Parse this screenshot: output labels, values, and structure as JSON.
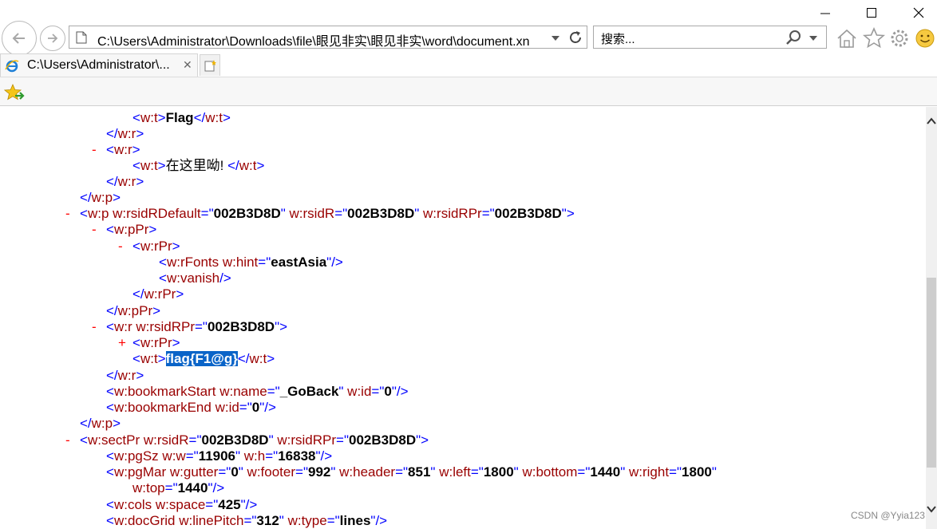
{
  "window": {
    "minimize_glyph": "—",
    "maximize_glyph": "☐",
    "close_glyph": "✕"
  },
  "address_bar": {
    "value": "C:\\Users\\Administrator\\Downloads\\file\\眼见非实\\眼见非实\\word\\document.xn"
  },
  "search": {
    "placeholder": "搜索..."
  },
  "tab": {
    "title": "C:\\Users\\Administrator\\...",
    "close_glyph": "✕"
  },
  "xml_lines": [
    {
      "toggle": "",
      "parts": [
        [
          "bl",
          "<"
        ],
        [
          "tg",
          "w:t"
        ],
        [
          "bl",
          ">"
        ],
        [
          "tx",
          "Flag"
        ],
        [
          "bl",
          "</"
        ],
        [
          "tg",
          "w:t"
        ],
        [
          "bl",
          ">"
        ]
      ]
    },
    {
      "toggle": "",
      "parts": [
        [
          "bl",
          "</"
        ],
        [
          "tg",
          "w:r"
        ],
        [
          "bl",
          ">"
        ]
      ]
    },
    {
      "toggle": "-",
      "parts": [
        [
          "bl",
          "<"
        ],
        [
          "tg",
          "w:r"
        ],
        [
          "bl",
          ">"
        ]
      ]
    },
    {
      "toggle": "",
      "parts": [
        [
          "bl",
          "<"
        ],
        [
          "tg",
          "w:t"
        ],
        [
          "bl",
          ">"
        ],
        [
          "txn",
          "在这里呦! "
        ],
        [
          "bl",
          "</"
        ],
        [
          "tg",
          "w:t"
        ],
        [
          "bl",
          ">"
        ]
      ]
    },
    {
      "toggle": "",
      "parts": [
        [
          "bl",
          "</"
        ],
        [
          "tg",
          "w:r"
        ],
        [
          "bl",
          ">"
        ]
      ]
    },
    {
      "toggle": "",
      "parts": [
        [
          "bl",
          "</"
        ],
        [
          "tg",
          "w:p"
        ],
        [
          "bl",
          ">"
        ]
      ]
    },
    {
      "toggle": "-",
      "parts": [
        [
          "bl",
          "<"
        ],
        [
          "tg",
          "w:p "
        ],
        [
          "an",
          "w:rsidRDefault"
        ],
        [
          "bl",
          "=\""
        ],
        [
          "av",
          "002B3D8D"
        ],
        [
          "bl",
          "\" "
        ],
        [
          "an",
          "w:rsidR"
        ],
        [
          "bl",
          "=\""
        ],
        [
          "av",
          "002B3D8D"
        ],
        [
          "bl",
          "\" "
        ],
        [
          "an",
          "w:rsidRPr"
        ],
        [
          "bl",
          "=\""
        ],
        [
          "av",
          "002B3D8D"
        ],
        [
          "bl",
          "\">"
        ]
      ]
    },
    {
      "toggle": "-",
      "parts": [
        [
          "bl",
          "<"
        ],
        [
          "tg",
          "w:pPr"
        ],
        [
          "bl",
          ">"
        ]
      ]
    },
    {
      "toggle": "-",
      "parts": [
        [
          "bl",
          "<"
        ],
        [
          "tg",
          "w:rPr"
        ],
        [
          "bl",
          ">"
        ]
      ]
    },
    {
      "toggle": "",
      "parts": [
        [
          "bl",
          "<"
        ],
        [
          "tg",
          "w:rFonts "
        ],
        [
          "an",
          "w:hint"
        ],
        [
          "bl",
          "=\""
        ],
        [
          "av",
          "eastAsia"
        ],
        [
          "bl",
          "\"/>"
        ]
      ]
    },
    {
      "toggle": "",
      "parts": [
        [
          "bl",
          "<"
        ],
        [
          "tg",
          "w:vanish"
        ],
        [
          "bl",
          "/>"
        ]
      ]
    },
    {
      "toggle": "",
      "parts": [
        [
          "bl",
          "</"
        ],
        [
          "tg",
          "w:rPr"
        ],
        [
          "bl",
          ">"
        ]
      ]
    },
    {
      "toggle": "",
      "parts": [
        [
          "bl",
          "</"
        ],
        [
          "tg",
          "w:pPr"
        ],
        [
          "bl",
          ">"
        ]
      ]
    },
    {
      "toggle": "-",
      "parts": [
        [
          "bl",
          "<"
        ],
        [
          "tg",
          "w:r "
        ],
        [
          "an",
          "w:rsidRPr"
        ],
        [
          "bl",
          "=\""
        ],
        [
          "av",
          "002B3D8D"
        ],
        [
          "bl",
          "\">"
        ]
      ]
    },
    {
      "toggle": "+",
      "parts": [
        [
          "bl",
          "<"
        ],
        [
          "tg",
          "w:rPr"
        ],
        [
          "bl",
          ">"
        ]
      ]
    },
    {
      "toggle": "",
      "parts": [
        [
          "bl",
          "<"
        ],
        [
          "tg",
          "w:t"
        ],
        [
          "bl",
          ">"
        ],
        [
          "hl",
          "flag{F1@g}"
        ],
        [
          "bl",
          "</"
        ],
        [
          "tg",
          "w:t"
        ],
        [
          "bl",
          ">"
        ]
      ]
    },
    {
      "toggle": "",
      "parts": [
        [
          "bl",
          "</"
        ],
        [
          "tg",
          "w:r"
        ],
        [
          "bl",
          ">"
        ]
      ]
    },
    {
      "toggle": "",
      "parts": [
        [
          "bl",
          "<"
        ],
        [
          "tg",
          "w:bookmarkStart "
        ],
        [
          "an",
          "w:name"
        ],
        [
          "bl",
          "=\""
        ],
        [
          "av",
          "_GoBack"
        ],
        [
          "bl",
          "\" "
        ],
        [
          "an",
          "w:id"
        ],
        [
          "bl",
          "=\""
        ],
        [
          "av",
          "0"
        ],
        [
          "bl",
          "\"/>"
        ]
      ]
    },
    {
      "toggle": "",
      "parts": [
        [
          "bl",
          "<"
        ],
        [
          "tg",
          "w:bookmarkEnd "
        ],
        [
          "an",
          "w:id"
        ],
        [
          "bl",
          "=\""
        ],
        [
          "av",
          "0"
        ],
        [
          "bl",
          "\"/>"
        ]
      ]
    },
    {
      "toggle": "",
      "parts": [
        [
          "bl",
          "</"
        ],
        [
          "tg",
          "w:p"
        ],
        [
          "bl",
          ">"
        ]
      ]
    },
    {
      "toggle": "-",
      "parts": [
        [
          "bl",
          "<"
        ],
        [
          "tg",
          "w:sectPr "
        ],
        [
          "an",
          "w:rsidR"
        ],
        [
          "bl",
          "=\""
        ],
        [
          "av",
          "002B3D8D"
        ],
        [
          "bl",
          "\" "
        ],
        [
          "an",
          "w:rsidRPr"
        ],
        [
          "bl",
          "=\""
        ],
        [
          "av",
          "002B3D8D"
        ],
        [
          "bl",
          "\">"
        ]
      ]
    },
    {
      "toggle": "",
      "parts": [
        [
          "bl",
          "<"
        ],
        [
          "tg",
          "w:pgSz "
        ],
        [
          "an",
          "w:w"
        ],
        [
          "bl",
          "=\""
        ],
        [
          "av",
          "11906"
        ],
        [
          "bl",
          "\" "
        ],
        [
          "an",
          "w:h"
        ],
        [
          "bl",
          "=\""
        ],
        [
          "av",
          "16838"
        ],
        [
          "bl",
          "\"/>"
        ]
      ]
    },
    {
      "toggle": "",
      "parts": [
        [
          "bl",
          "<"
        ],
        [
          "tg",
          "w:pgMar "
        ],
        [
          "an",
          "w:gutter"
        ],
        [
          "bl",
          "=\""
        ],
        [
          "av",
          "0"
        ],
        [
          "bl",
          "\" "
        ],
        [
          "an",
          "w:footer"
        ],
        [
          "bl",
          "=\""
        ],
        [
          "av",
          "992"
        ],
        [
          "bl",
          "\" "
        ],
        [
          "an",
          "w:header"
        ],
        [
          "bl",
          "=\""
        ],
        [
          "av",
          "851"
        ],
        [
          "bl",
          "\" "
        ],
        [
          "an",
          "w:left"
        ],
        [
          "bl",
          "=\""
        ],
        [
          "av",
          "1800"
        ],
        [
          "bl",
          "\" "
        ],
        [
          "an",
          "w:bottom"
        ],
        [
          "bl",
          "=\""
        ],
        [
          "av",
          "1440"
        ],
        [
          "bl",
          "\" "
        ],
        [
          "an",
          "w:right"
        ],
        [
          "bl",
          "=\""
        ],
        [
          "av",
          "1800"
        ],
        [
          "bl",
          "\""
        ]
      ]
    },
    {
      "toggle": "",
      "parts": [
        [
          "an",
          "w:top"
        ],
        [
          "bl",
          "=\""
        ],
        [
          "av",
          "1440"
        ],
        [
          "bl",
          "\"/>"
        ]
      ]
    },
    {
      "toggle": "",
      "parts": [
        [
          "bl",
          "<"
        ],
        [
          "tg",
          "w:cols "
        ],
        [
          "an",
          "w:space"
        ],
        [
          "bl",
          "=\""
        ],
        [
          "av",
          "425"
        ],
        [
          "bl",
          "\"/>"
        ]
      ]
    },
    {
      "toggle": "",
      "parts": [
        [
          "bl",
          "<"
        ],
        [
          "tg",
          "w:docGrid "
        ],
        [
          "an",
          "w:linePitch"
        ],
        [
          "bl",
          "=\""
        ],
        [
          "av",
          "312"
        ],
        [
          "bl",
          "\" "
        ],
        [
          "an",
          "w:type"
        ],
        [
          "bl",
          "=\""
        ],
        [
          "av",
          "lines"
        ],
        [
          "bl",
          "\"/>"
        ]
      ]
    }
  ],
  "watermark": "CSDN @Yyia123"
}
